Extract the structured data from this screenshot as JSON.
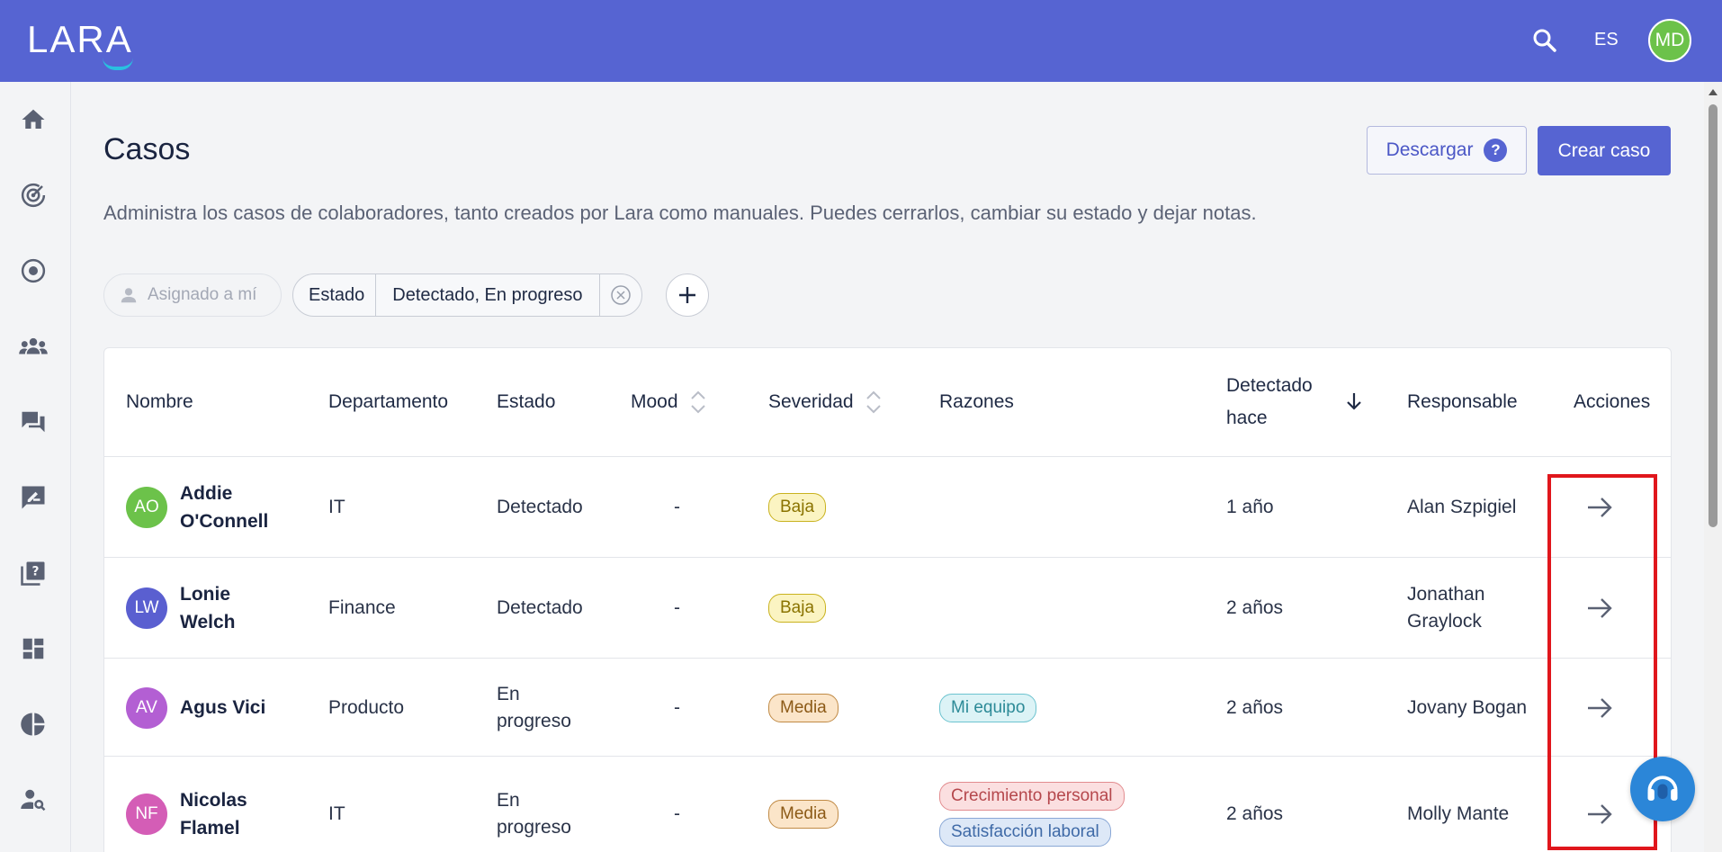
{
  "header": {
    "logo": "LARA",
    "lang": "ES",
    "avatar_initials": "MD"
  },
  "page": {
    "title": "Casos",
    "subtitle": "Administra los casos de colaboradores, tanto creados por Lara como manuales. Puedes cerrarlos, cambiar su estado y dejar notas.",
    "download_label": "Descargar",
    "create_label": "Crear caso"
  },
  "filters": {
    "assigned_label": "Asignado a mí",
    "state_key": "Estado",
    "state_value": "Detectado, En progreso"
  },
  "table": {
    "columns": {
      "nombre": "Nombre",
      "departamento": "Departamento",
      "estado": "Estado",
      "mood": "Mood",
      "severidad": "Severidad",
      "razones": "Razones",
      "detectado_1": "Detectado",
      "detectado_2": "hace",
      "responsable": "Responsable",
      "acciones": "Acciones"
    },
    "rows": [
      {
        "initials": "AO",
        "avatar_color": "#6cc24a",
        "name_1": "Addie",
        "name_2": "O'Connell",
        "dept": "IT",
        "estado_1": "Detectado",
        "estado_2": "",
        "mood": "-",
        "severidad": "Baja",
        "razon_1": "",
        "razon_2": "",
        "detectado": "1 año",
        "resp_1": "Alan Szpigiel",
        "resp_2": ""
      },
      {
        "initials": "LW",
        "avatar_color": "#5a5fd0",
        "name_1": "Lonie",
        "name_2": "Welch",
        "dept": "Finance",
        "estado_1": "Detectado",
        "estado_2": "",
        "mood": "-",
        "severidad": "Baja",
        "razon_1": "",
        "razon_2": "",
        "detectado": "2 años",
        "resp_1": "Jonathan",
        "resp_2": "Graylock"
      },
      {
        "initials": "AV",
        "avatar_color": "#b35fd3",
        "name_1": "Agus Vici",
        "name_2": "",
        "dept": "Producto",
        "estado_1": "En",
        "estado_2": "progreso",
        "mood": "-",
        "severidad": "Media",
        "razon_1": "Mi equipo",
        "razon_2": "",
        "detectado": "2 años",
        "resp_1": "Jovany Bogan",
        "resp_2": ""
      },
      {
        "initials": "NF",
        "avatar_color": "#d45db6",
        "name_1": "Nicolas",
        "name_2": "Flamel",
        "dept": "IT",
        "estado_1": "En",
        "estado_2": "progreso",
        "mood": "-",
        "severidad": "Media",
        "razon_1": "Crecimiento personal",
        "razon_2": "Satisfacción laboral",
        "detectado": "2 años",
        "resp_1": "Molly Mante",
        "resp_2": ""
      }
    ]
  }
}
